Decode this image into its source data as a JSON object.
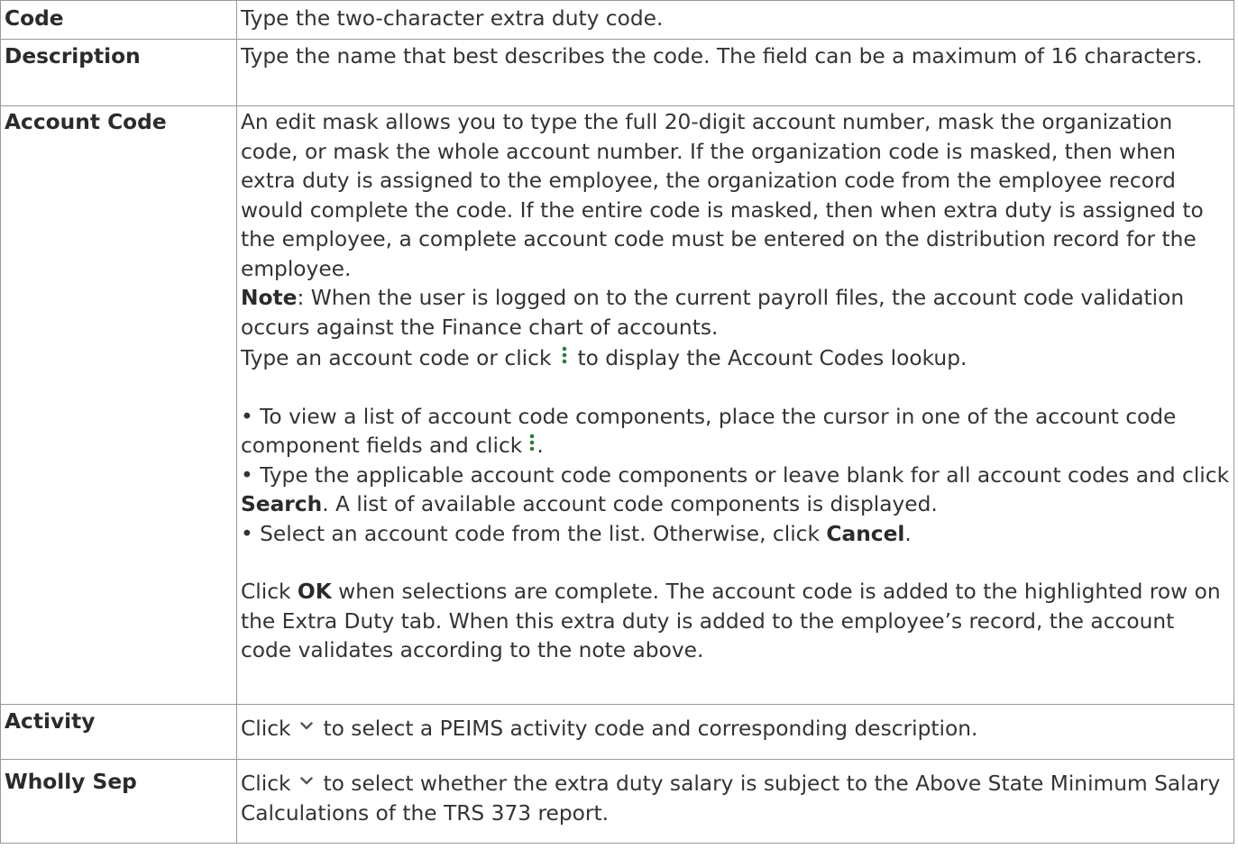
{
  "rows": {
    "code": {
      "label": "Code",
      "text": "Type the two-character extra duty code."
    },
    "description": {
      "label": "Description",
      "text": "Type the name that best describes the code. The field can be a maximum of 16 characters."
    },
    "account_code": {
      "label": "Account Code",
      "intro": "An edit mask allows you to type the full 20-digit account number, mask the organization code, or mask the whole account number. If the organization code is masked, then when extra duty is assigned to the employee, the organization code from the employee record would complete the code. If the entire code is masked, then when extra duty is assigned to the employee, a complete account code must be entered on the distribution record for the employee.",
      "note_label": "Note",
      "note_text": ": When the user is logged on to the current payroll files, the account code validation occurs against the Finance chart of accounts.",
      "lookup_before": "Type an account code or click",
      "lookup_after": "to display the Account Codes lookup.",
      "bullet1": "• To view a list of account code components, place the cursor in one of the account code component fields and click",
      "bullet1_end": ".",
      "bullet2_before": "• Type the applicable account code components or leave blank for all account codes and click ",
      "bullet2_bold": "Search",
      "bullet2_after": ". A list of available account code components is displayed.",
      "bullet3_before": "• Select an account code from the list. Otherwise, click ",
      "bullet3_bold": "Cancel",
      "bullet3_after": ".",
      "final_before": "Click ",
      "final_bold": "OK",
      "final_after": " when selections are complete. The account code is added to the highlighted row on the Extra Duty tab. When this extra duty is added to the employee’s record, the account code validates according to the note above."
    },
    "activity": {
      "label": "Activity",
      "before": "Click",
      "after": "to select a PEIMS activity code and corresponding description."
    },
    "wholly_sep": {
      "label": "Wholly Sep",
      "before": "Click",
      "after": "to select whether the extra duty salary is subject to the Above State Minimum Salary Calculations of the TRS 373 report."
    }
  },
  "icons": {
    "lookup": "vertical-dots-icon",
    "dropdown": "chevron-down-icon",
    "icon_color": "#2e7d32",
    "chevron_color": "#555555"
  },
  "colors": {
    "text": "#333333",
    "border": "#999999",
    "background": "#ffffff"
  }
}
